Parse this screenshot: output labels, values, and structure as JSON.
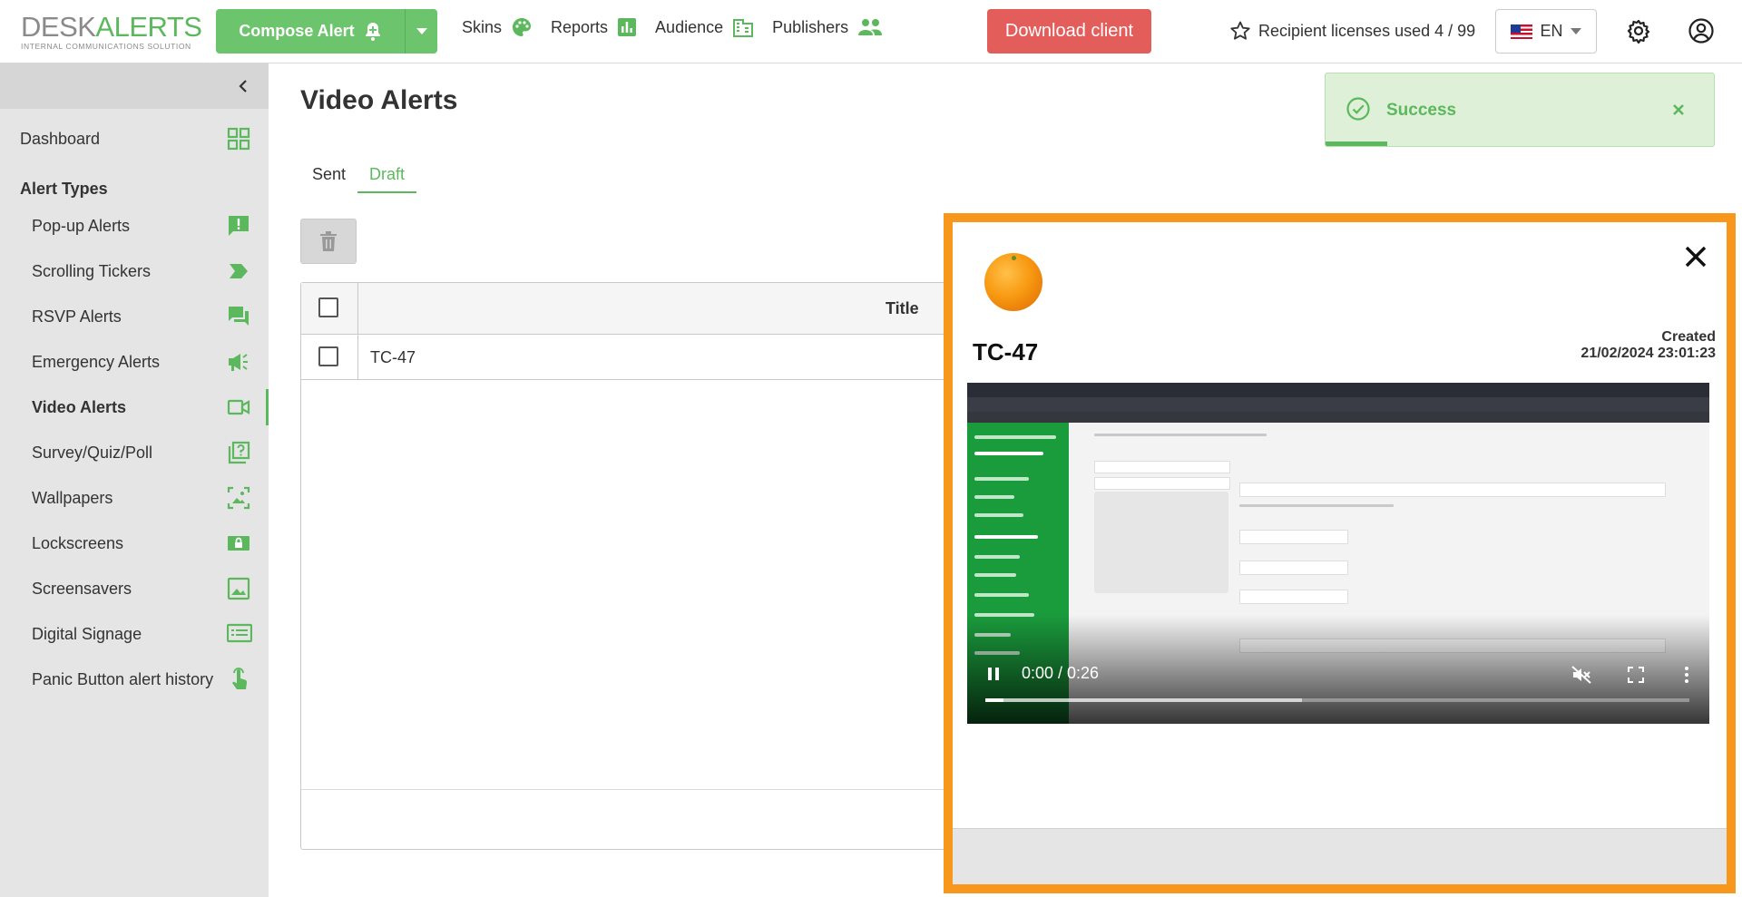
{
  "header": {
    "logo_desk": "DESK",
    "logo_alerts": "ALERTS",
    "logo_tagline": "INTERNAL COMMUNICATIONS SOLUTION",
    "compose_label": "Compose Alert",
    "nav": [
      {
        "label": "Skins",
        "icon": "palette-icon"
      },
      {
        "label": "Reports",
        "icon": "bar-chart-icon"
      },
      {
        "label": "Audience",
        "icon": "audience-icon"
      },
      {
        "label": "Publishers",
        "icon": "people-icon"
      }
    ],
    "download_label": "Download client",
    "licenses_text": "Recipient licenses used 4 / 99",
    "language": "EN"
  },
  "sidebar": {
    "dashboard": "Dashboard",
    "section_heading": "Alert Types",
    "items": [
      {
        "label": "Pop-up Alerts",
        "icon": "popup-alert-icon"
      },
      {
        "label": "Scrolling Tickers",
        "icon": "ticker-icon"
      },
      {
        "label": "RSVP Alerts",
        "icon": "chat-icon"
      },
      {
        "label": "Emergency Alerts",
        "icon": "megaphone-icon"
      },
      {
        "label": "Video Alerts",
        "icon": "video-icon"
      },
      {
        "label": "Survey/Quiz/Poll",
        "icon": "survey-icon"
      },
      {
        "label": "Wallpapers",
        "icon": "wallpaper-icon"
      },
      {
        "label": "Lockscreens",
        "icon": "lockscreen-icon"
      },
      {
        "label": "Screensavers",
        "icon": "screensaver-icon"
      },
      {
        "label": "Digital Signage",
        "icon": "signage-icon"
      },
      {
        "label": "Panic Button alert history",
        "icon": "panic-button-icon"
      }
    ],
    "active": "Video Alerts"
  },
  "main": {
    "title": "Video Alerts",
    "tabs": [
      "Sent",
      "Draft"
    ],
    "active_tab": "Draft",
    "table": {
      "column_title": "Title",
      "rows": [
        {
          "title": "TC-47"
        }
      ]
    }
  },
  "toast": {
    "message": "Success"
  },
  "preview": {
    "title": "TC-47",
    "created_label": "Created",
    "created_value": "21/02/2024 23:01:23",
    "video": {
      "time": "0:00 / 0:26",
      "played_fraction": 0.0,
      "buffered_fraction": 0.45
    }
  },
  "colors": {
    "accent": "#5cb85c",
    "danger": "#e35d5b",
    "preview_border": "#f7981d"
  }
}
